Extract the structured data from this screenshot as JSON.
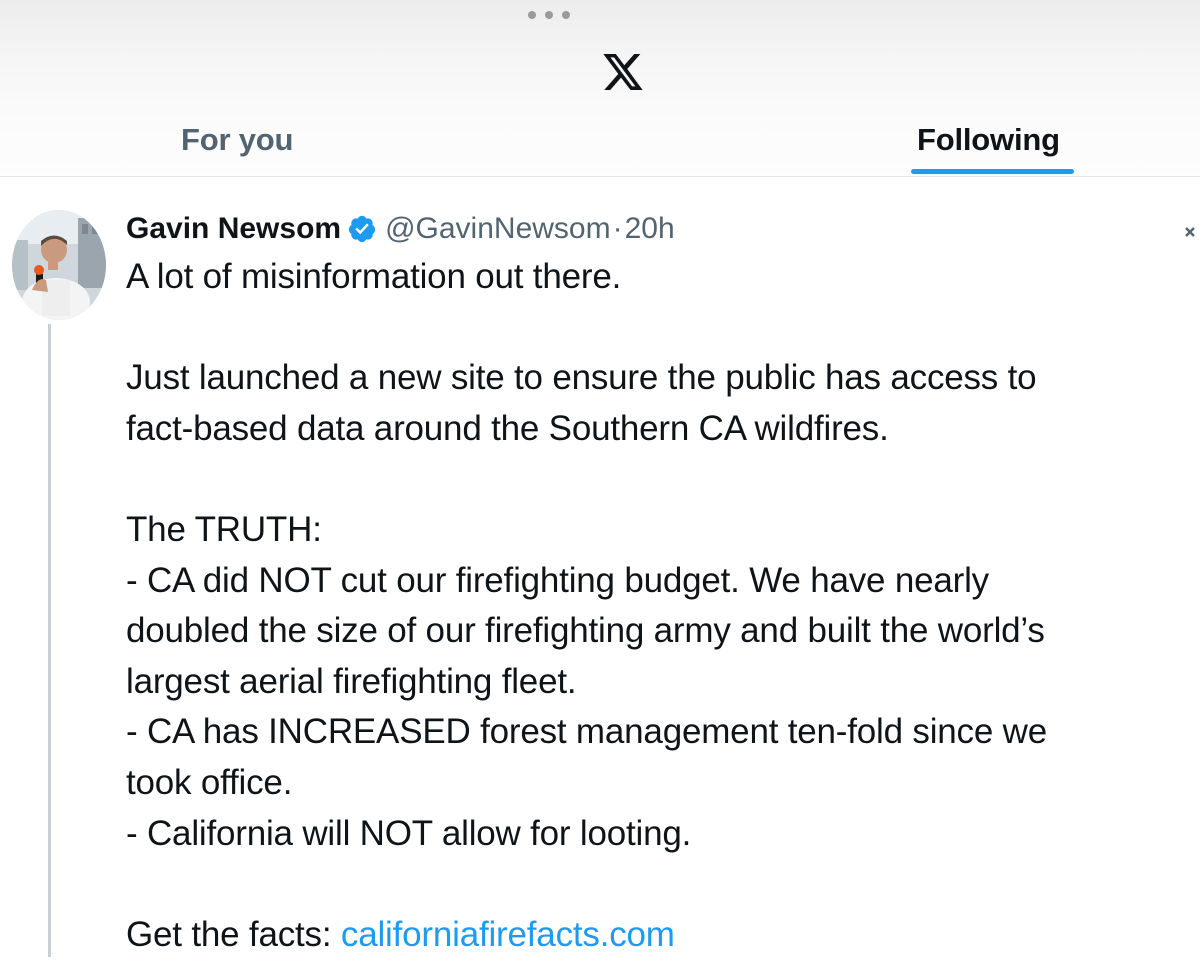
{
  "app": {
    "logo_icon": "x-logo-icon",
    "grabber_icon": "more-dots-icon"
  },
  "tabs": [
    {
      "label": "For you",
      "selected": false
    },
    {
      "label": "Following",
      "selected": true
    }
  ],
  "colors": {
    "accent": "#1d9bf0",
    "text_primary": "#0f1419",
    "text_secondary": "#536471"
  },
  "tweet": {
    "author": {
      "display_name": "Gavin Newsom",
      "verified": true,
      "handle": "@GavinNewsom",
      "separator": "·",
      "time": "20h"
    },
    "lines": [
      "A lot of misinformation out there.",
      "",
      "Just launched a new site to ensure the public has access to",
      "fact-based data around the Southern CA wildfires.",
      "",
      "The TRUTH:",
      "- CA did NOT cut our firefighting budget. We have nearly",
      "doubled the size of our firefighting army and built the world’s",
      "largest aerial firefighting fleet.",
      "- CA has INCREASED forest management ten-fold since we",
      "took office.",
      "- California will NOT allow for looting.",
      ""
    ],
    "facts_prefix": "Get the facts: ",
    "facts_link": "californiafirefacts.com"
  }
}
